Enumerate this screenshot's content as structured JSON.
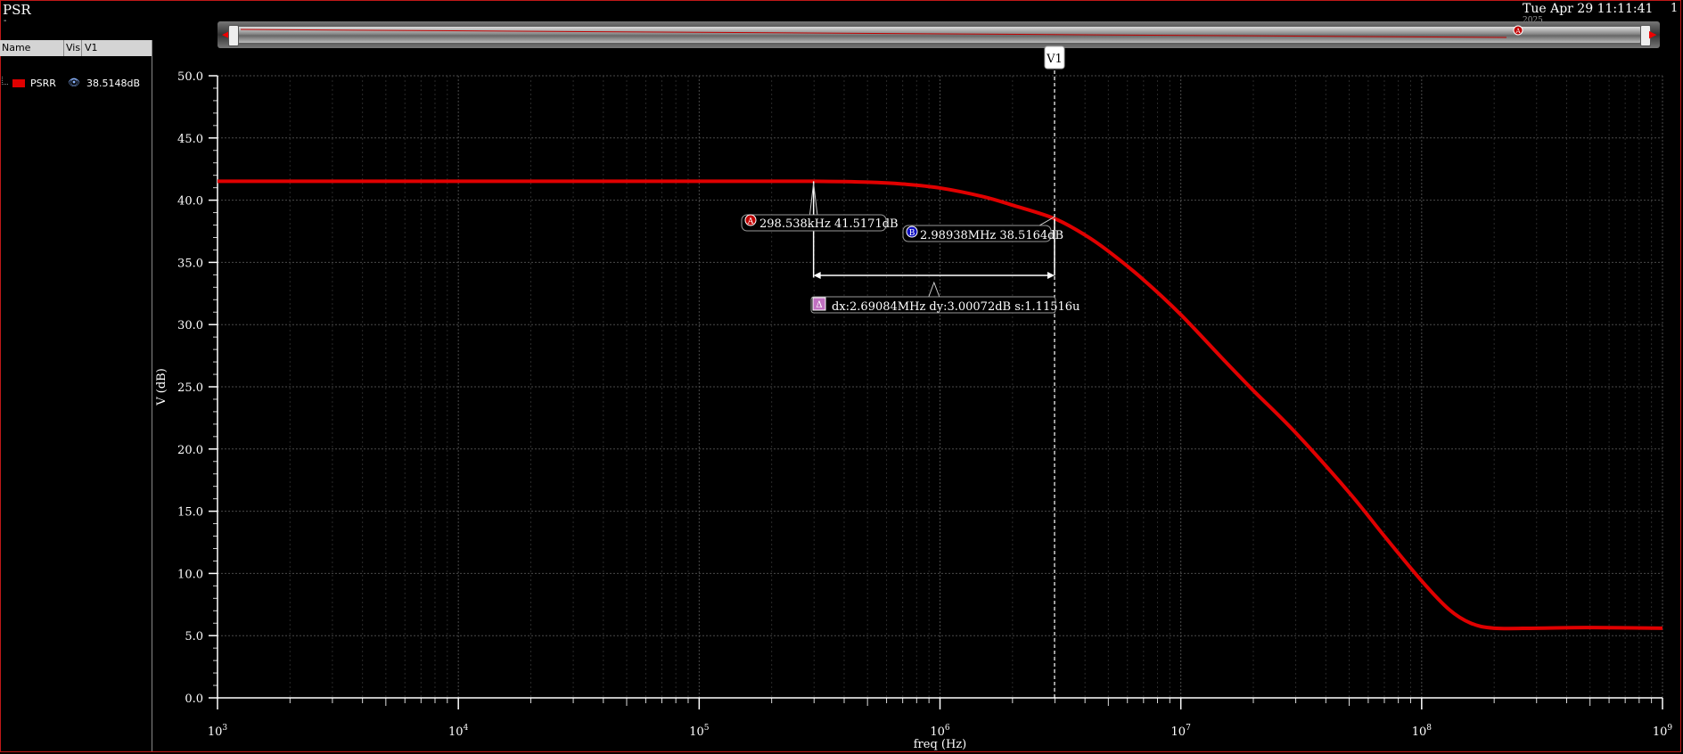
{
  "window": {
    "title": "PSR",
    "title_sub": "-",
    "date": "Tue Apr 29 11:11:41",
    "date_sub": "2025",
    "page": "1"
  },
  "legend": {
    "headers": [
      "Name",
      "Vis",
      "V1"
    ],
    "entries": [
      {
        "name": "PSRR",
        "value": "38.5148dB",
        "color": "#e00000"
      }
    ]
  },
  "cursor": {
    "label": "V1"
  },
  "markers": {
    "a": {
      "badge": "A",
      "text": "298.538kHz 41.5171dB"
    },
    "b": {
      "badge": "B",
      "text": "2.98938MHz 38.5164dB"
    },
    "delta": {
      "badge": "Δ",
      "text": "dx:2.69084MHz dy:3.00072dB s:1.11516u"
    }
  },
  "chart_data": {
    "type": "line",
    "xlabel": "freq (Hz)",
    "ylabel": "V (dB)",
    "xscale": "log",
    "xlim": [
      1000,
      1000000000
    ],
    "ylim": [
      0,
      50
    ],
    "xticks": [
      1000,
      10000,
      100000,
      1000000,
      10000000,
      100000000,
      1000000000
    ],
    "yticks": [
      0,
      5,
      10,
      15,
      20,
      25,
      30,
      35,
      40,
      45,
      50
    ],
    "ytick_labels": [
      "0.0",
      "5.0",
      "10.0",
      "15.0",
      "20.0",
      "25.0",
      "30.0",
      "35.0",
      "40.0",
      "45.0",
      "50.0"
    ],
    "grid": true,
    "series": [
      {
        "name": "PSRR",
        "color": "#e00000",
        "x": [
          1000,
          10000,
          100000,
          200000,
          298538,
          500000,
          700000,
          1000000,
          1500000,
          2000000,
          2989380,
          4000000,
          5000000,
          7000000,
          10000000,
          15000000,
          20000000,
          30000000,
          50000000,
          70000000,
          100000000,
          130000000,
          160000000,
          200000000,
          300000000,
          500000000,
          1000000000
        ],
        "y": [
          41.52,
          41.52,
          41.52,
          41.52,
          41.52,
          41.45,
          41.3,
          40.98,
          40.3,
          39.6,
          38.52,
          37.2,
          35.9,
          33.6,
          30.8,
          27.2,
          24.7,
          21.3,
          16.5,
          13.0,
          9.4,
          7.1,
          6.0,
          5.6,
          5.6,
          5.65,
          5.6
        ]
      }
    ],
    "cursor_x": 2989380,
    "marker_a": {
      "x": 298538,
      "y": 41.5171
    },
    "marker_b": {
      "x": 2989380,
      "y": 38.5164
    }
  }
}
